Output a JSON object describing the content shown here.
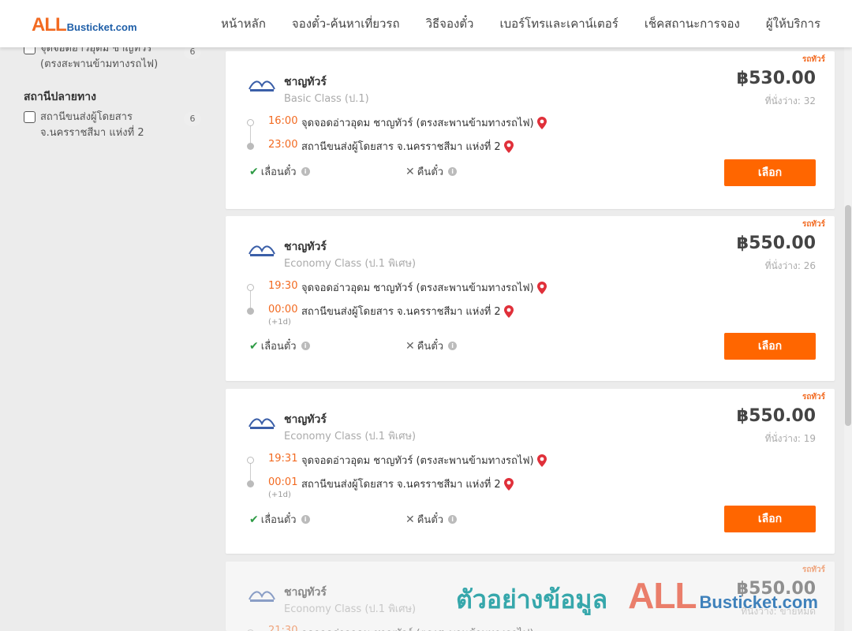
{
  "header": {
    "logo_main": "ALL",
    "logo_rest": "Busticket.com",
    "nav": [
      "หน้าหลัก",
      "จองตั๋ว-ค้นหาเที่ยวรถ",
      "วิธีจองตั๋ว",
      "เบอร์โทรและเคาน์เตอร์",
      "เช็คสถานะการจอง",
      "ผู้ให้บริการ"
    ]
  },
  "sidebar": {
    "origin_item_label": "จุดจอดอ่าวอุดม ชาญทัวร์ (ตรงสะพานข้ามทางรถไฟ)",
    "origin_item_count": "6",
    "destination_title": "สถานีปลายทาง",
    "destination_item_label": "สถานีขนส่งผู้โดยสาร จ.นครราชสีมา แห่งที่ 2",
    "destination_item_count": "6"
  },
  "cards": [
    {
      "tag": "รถทัวร์",
      "operator": "ชาญทัวร์",
      "bus_class": "Basic Class (ป.1)",
      "price": "฿530.00",
      "seats": "ที่นั่งว่าง: 32",
      "depart_time": "16:00",
      "depart_stop": "จุดจอดอ่าวอุดม ชาญทัวร์ (ตรงสะพานข้ามทางรถไฟ)",
      "arrive_time": "23:00",
      "arrive_stop": "สถานีขนส่งผู้โดยสาร จ.นครราชสีมา แห่งที่ 2",
      "next_day": "",
      "policy_change": "เลื่อนตั๋ว",
      "policy_refund": "คืนตั๋ว",
      "button": "เลือก"
    },
    {
      "tag": "รถทัวร์",
      "operator": "ชาญทัวร์",
      "bus_class": "Economy Class (ป.1 พิเศษ)",
      "price": "฿550.00",
      "seats": "ที่นั่งว่าง: 26",
      "depart_time": "19:30",
      "depart_stop": "จุดจอดอ่าวอุดม ชาญทัวร์ (ตรงสะพานข้ามทางรถไฟ)",
      "arrive_time": "00:00",
      "arrive_stop": "สถานีขนส่งผู้โดยสาร จ.นครราชสีมา แห่งที่ 2",
      "next_day": "(+1d)",
      "policy_change": "เลื่อนตั๋ว",
      "policy_refund": "คืนตั๋ว",
      "button": "เลือก"
    },
    {
      "tag": "รถทัวร์",
      "operator": "ชาญทัวร์",
      "bus_class": "Economy Class (ป.1 พิเศษ)",
      "price": "฿550.00",
      "seats": "ที่นั่งว่าง: 19",
      "depart_time": "19:31",
      "depart_stop": "จุดจอดอ่าวอุดม ชาญทัวร์ (ตรงสะพานข้ามทางรถไฟ)",
      "arrive_time": "00:01",
      "arrive_stop": "สถานีขนส่งผู้โดยสาร จ.นครราชสีมา แห่งที่ 2",
      "next_day": "(+1d)",
      "policy_change": "เลื่อนตั๋ว",
      "policy_refund": "คืนตั๋ว",
      "button": "เลือก"
    },
    {
      "tag": "รถทัวร์",
      "operator": "ชาญทัวร์",
      "bus_class": "Economy Class (ป.1 พิเศษ)",
      "price": "฿550.00",
      "seats": "ที่นั่งว่าง: ขายหมด",
      "depart_time": "21:30",
      "depart_stop": "จุดจอดอ่าวอุดม ชาญทัวร์ (ตรงสะพานข้ามทางรถไฟ)"
    }
  ],
  "watermark": {
    "text": "ตัวอย่างข้อมูล",
    "logo_main": "ALL",
    "logo_rest": "Busticket.com"
  },
  "colors": {
    "accent": "#ff6600",
    "brand_orange": "#f26a21",
    "brand_blue": "#1f5fa8",
    "check_green": "#2e9b45"
  }
}
